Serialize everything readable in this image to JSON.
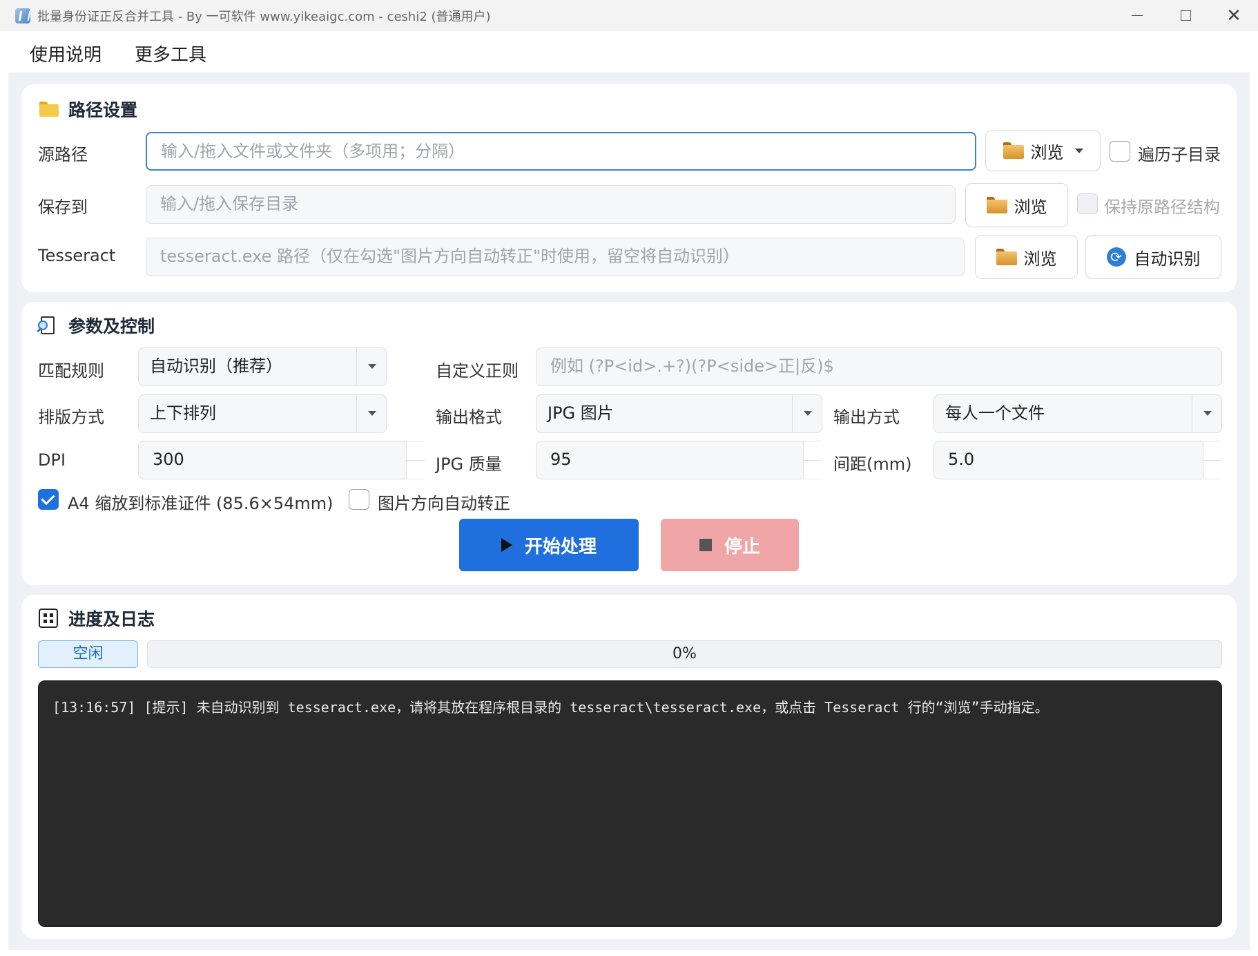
{
  "window": {
    "title": "批量身份证正反合并工具 - By 一可软件 www.yikeaigc.com  -  ceshi2 (普通用户)"
  },
  "menu": {
    "items": [
      "使用说明",
      "更多工具"
    ]
  },
  "path_settings": {
    "title": "路径设置",
    "source": {
      "label": "源路径",
      "placeholder": "输入/拖入文件或文件夹（多项用；分隔）",
      "browse": "浏览",
      "recursive_label": "遍历子目录",
      "recursive_checked": false
    },
    "save": {
      "label": "保存到",
      "placeholder": "输入/拖入保存目录",
      "browse": "浏览",
      "keep_structure_label": "保持原路径结构",
      "keep_structure_checked": false,
      "keep_structure_disabled": true
    },
    "tesseract": {
      "label": "Tesseract",
      "placeholder": "tesseract.exe 路径（仅在勾选\"图片方向自动转正\"时使用，留空将自动识别）",
      "browse": "浏览",
      "auto_detect": "自动识别"
    }
  },
  "params": {
    "title": "参数及控制",
    "match_rule": {
      "label": "匹配规则",
      "value": "自动识别（推荐）"
    },
    "custom_regex": {
      "label": "自定义正则",
      "placeholder": "例如 (?P<id>.+?)(?P<side>正|反)$"
    },
    "layout": {
      "label": "排版方式",
      "value": "上下排列"
    },
    "output_format": {
      "label": "输出格式",
      "value": "JPG 图片"
    },
    "output_mode": {
      "label": "输出方式",
      "value": "每人一个文件"
    },
    "dpi": {
      "label": "DPI",
      "value": "300"
    },
    "jpg_quality": {
      "label": "JPG 质量",
      "value": "95"
    },
    "spacing": {
      "label": "间距(mm)",
      "value": "5.0"
    },
    "a4_scale": {
      "label": "A4 缩放到标准证件 (85.6×54mm)",
      "checked": true
    },
    "auto_rotate": {
      "label": "图片方向自动转正",
      "checked": false
    },
    "start_button": "开始处理",
    "stop_button": "停止"
  },
  "progress": {
    "title": "进度及日志",
    "status": "空闲",
    "percent_text": "0%",
    "percent": 0,
    "log": [
      "[13:16:57] [提示] 未自动识别到 tesseract.exe，请将其放在程序根目录的 tesseract\\tesseract.exe，或点击 Tesseract 行的“浏览”手动指定。"
    ]
  },
  "colors": {
    "primary": "#1f6fde",
    "stop_disabled": "#f0a6a6",
    "status_bg": "#e3f0fd",
    "log_bg": "#2a2a2a"
  }
}
